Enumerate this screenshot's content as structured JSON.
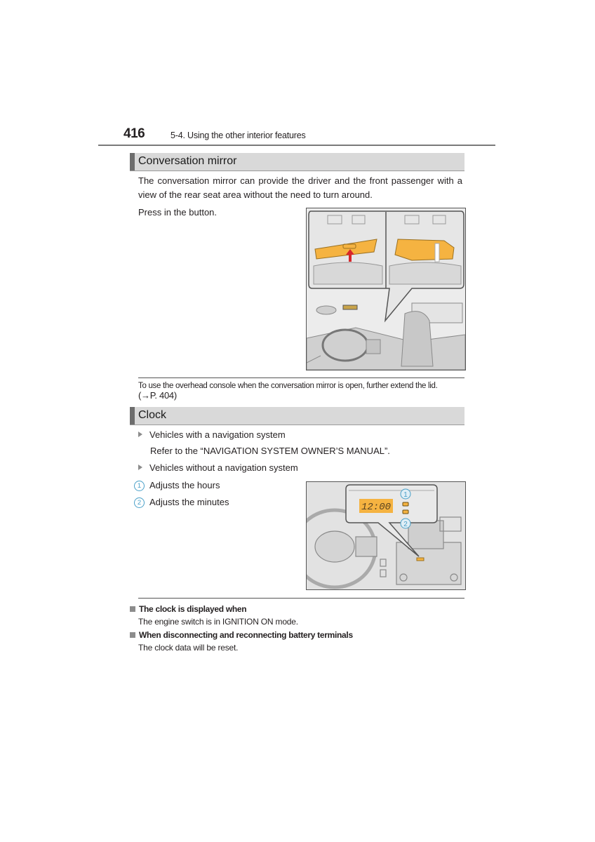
{
  "header": {
    "page_number": "416",
    "section_path": "5-4. Using the other interior features"
  },
  "conversation_mirror": {
    "title": "Conversation mirror",
    "intro": "The conversation mirror can provide the driver and the front passenger with a view of the rear seat area without the need to turn around.",
    "instruction": "Press in the button.",
    "figure_label": "Overhead conversation mirror illustration",
    "note": "To use the overhead console when the conversation mirror is open, further extend the lid.",
    "note_ref": "(→P. 404)"
  },
  "clock": {
    "title": "Clock",
    "bullets": [
      {
        "label": "Vehicles with a navigation system",
        "detail": "Refer to the “NAVIGATION SYSTEM OWNER’S MANUAL”."
      },
      {
        "label": "Vehicles without a navigation system"
      }
    ],
    "callouts": [
      {
        "num": "1",
        "label": "Adjusts the hours"
      },
      {
        "num": "2",
        "label": "Adjusts the minutes"
      }
    ],
    "display_time": "12:00",
    "figure_label": "Clock adjustment buttons illustration"
  },
  "footnotes": [
    {
      "heading": "The clock is displayed when",
      "body": "The engine switch is in IGNITION ON mode."
    },
    {
      "heading": "When disconnecting and reconnecting battery terminals",
      "body": "The clock data will be reset."
    }
  ],
  "colors": {
    "highlight_orange": "#f5b341",
    "callout_blue": "#4aa0c8",
    "arrow_red": "#d8262b"
  }
}
